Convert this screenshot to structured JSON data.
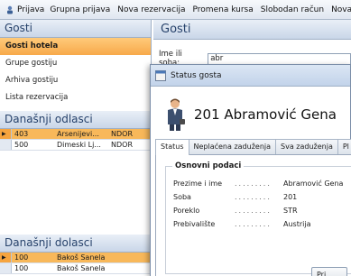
{
  "toolbar": {
    "items": [
      "Prijava",
      "Grupna prijava",
      "Nova rezervacija",
      "Promena kursa",
      "Slobodan račun",
      "Nova"
    ]
  },
  "gosti_panel": {
    "header": "Gosti",
    "nav": [
      "Gosti hotela",
      "Grupe gostiju",
      "Arhiva gostiju",
      "Lista rezervacija"
    ]
  },
  "odlasci": {
    "header": "Današnji odlasci",
    "rows": [
      {
        "room": "403",
        "name": "Arsenijevi...",
        "code": "NDOR"
      },
      {
        "room": "500",
        "name": "Dimeski Lj...",
        "code": "NDOR"
      }
    ]
  },
  "dolasci": {
    "header": "Današnji dolasci",
    "rows": [
      {
        "room": "100",
        "name": "Bakoš Sanela",
        "code": ""
      },
      {
        "room": "100",
        "name": "Bakoš Sanela",
        "code": ""
      }
    ]
  },
  "right_panel": {
    "header": "Gosti",
    "search_label": "Ime ili soba:",
    "search_value": "abr"
  },
  "dialog": {
    "title": "Status gosta",
    "guest_title": "201 Abramović Gena",
    "tabs": [
      "Status",
      "Neplaćena zaduženja",
      "Sva zaduženja",
      "Pl"
    ],
    "group_title": "Osnovni podaci",
    "fields": [
      {
        "label": "Prezime i ime",
        "value": "Abramović Gena"
      },
      {
        "label": "Soba",
        "value": "201"
      },
      {
        "label": "Poreklo",
        "value": "STR"
      },
      {
        "label": "Prebivalište",
        "value": "Austrija"
      }
    ],
    "print_button": "Pri"
  },
  "colors": {
    "selection_orange": "#f7a94a",
    "header_blue_text": "#27426b"
  }
}
